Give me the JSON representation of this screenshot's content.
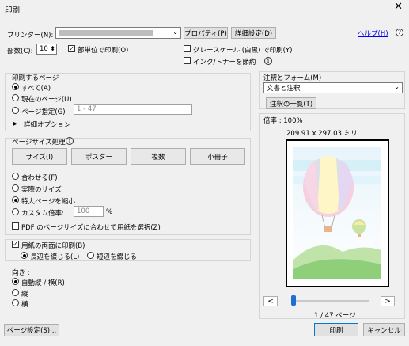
{
  "window": {
    "title": "印刷",
    "close_glyph": "✕"
  },
  "printer": {
    "label": "プリンター(N):",
    "properties_button": "プロパティ(P)",
    "advanced_button": "詳細設定(D)",
    "help_link": "ヘルプ(H)",
    "help_icon_glyph": "?"
  },
  "copies": {
    "label": "部数(C):",
    "value": "10",
    "spin_glyph": "⬍",
    "collate_label": "部単位で印刷(O)",
    "collate_checked": true
  },
  "options": {
    "grayscale_label": "グレースケール (白黒) で印刷(Y)",
    "grayscale_checked": false,
    "save_ink_label": "インク/トナーを節約",
    "save_ink_checked": false,
    "info_glyph": "i"
  },
  "pages_to_print": {
    "heading": "印刷するページ",
    "all_label": "すべて(A)",
    "current_label": "現在のページ(U)",
    "range_label": "ページ指定(G)",
    "range_placeholder": "1 - 47",
    "selected": "all",
    "more_options_label": "詳細オプション",
    "expand_glyph": "▶"
  },
  "page_sizing": {
    "heading": "ページサイズ処理",
    "info_glyph": "i",
    "buttons": [
      "サイズ(I)",
      "ポスター",
      "複数",
      "小冊子"
    ],
    "fit_label": "合わせる(F)",
    "actual_label": "実際のサイズ",
    "shrink_label": "特大ページを縮小",
    "custom_label": "カスタム倍率:",
    "custom_value": "100",
    "percent_sign": "%",
    "selected": "shrink",
    "pdf_pagesize_label": "PDF のページサイズに合わせて用紙を選択(Z)",
    "pdf_pagesize_checked": false
  },
  "duplex": {
    "label": "用紙の両面に印刷(B)",
    "checked": true,
    "long_edge_label": "長辺を綴じる(L)",
    "short_edge_label": "短辺を綴じる",
    "selected": "long"
  },
  "orientation": {
    "heading": "向き :",
    "auto_label": "自動縦 / 横(R)",
    "portrait_label": "縦",
    "landscape_label": "横",
    "selected": "auto"
  },
  "comments": {
    "heading": "注釈とフォーム(M)",
    "selected_value": "文書と注釈",
    "summarize_button": "注釈の一覧(T)",
    "dropdown_glyph": "⌄"
  },
  "preview": {
    "scale_label": "倍率 : 100%",
    "dimensions": "209.91 x 297.03 ミリ",
    "page_counter": "1 / 47 ページ",
    "prev_glyph": "<",
    "next_glyph": ">",
    "slider_fraction": 0.0
  },
  "footer": {
    "page_setup_button": "ページ設定(S)...",
    "print_button": "印刷",
    "cancel_button": "キャンセル"
  },
  "colors": {
    "dialog_bg": "#f0f0f0",
    "button_bg": "#e1e1e1",
    "accent_blue": "#0078d7",
    "slider_blue": "#1e6ed7"
  }
}
